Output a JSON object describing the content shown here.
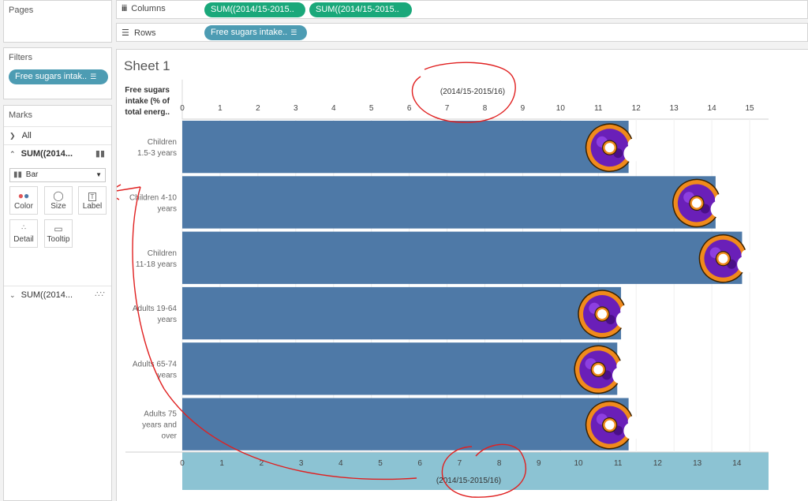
{
  "pages": {
    "title": "Pages"
  },
  "shelves": {
    "columns_label": "Columns",
    "rows_label": "Rows",
    "column_pills": [
      "SUM((2014/15-2015..",
      "SUM((2014/15-2015.."
    ],
    "row_pills": [
      "Free sugars intake.."
    ]
  },
  "filters": {
    "title": "Filters",
    "pills": [
      "Free sugars intak.."
    ]
  },
  "marks": {
    "title": "Marks",
    "all_label": "All",
    "card1_label": "SUM((2014...",
    "mark_type": "Bar",
    "buttons": [
      "Color",
      "Size",
      "Label",
      "Detail",
      "Tooltip"
    ],
    "card2_label": "SUM((2014..."
  },
  "sheet": {
    "title": "Sheet 1",
    "row_header": [
      "Free sugars",
      "intake (% of",
      "total energ.."
    ]
  },
  "chart_data": {
    "type": "bar",
    "orientation": "horizontal",
    "categories": [
      [
        "Children",
        "1.5-3 years"
      ],
      [
        "Children 4-10",
        "years"
      ],
      [
        "Children",
        "11-18 years"
      ],
      [
        "Adults 19-64",
        "years"
      ],
      [
        "Adults 65-74",
        "years"
      ],
      [
        "Adults 75",
        "years and",
        "over"
      ]
    ],
    "values": [
      11.8,
      14.1,
      14.8,
      11.6,
      11.5,
      11.8
    ],
    "top_axis": {
      "title": "(2014/15-2015/16)",
      "ticks": [
        0,
        1,
        2,
        3,
        4,
        5,
        6,
        7,
        8,
        9,
        10,
        11,
        12,
        13,
        14,
        15
      ],
      "range": [
        0,
        15.5
      ]
    },
    "bottom_axis": {
      "title": "(2014/15-2015/16)",
      "ticks": [
        0,
        1,
        2,
        3,
        4,
        5,
        6,
        7,
        8,
        9,
        10,
        11,
        12,
        13,
        14
      ],
      "range": [
        0,
        14.8
      ]
    },
    "bar_color": "#4e79a7",
    "bottom_axis_band_color": "#8cc3d3",
    "annotation_color": "#e02020",
    "mark_icon": "donut-icon"
  }
}
